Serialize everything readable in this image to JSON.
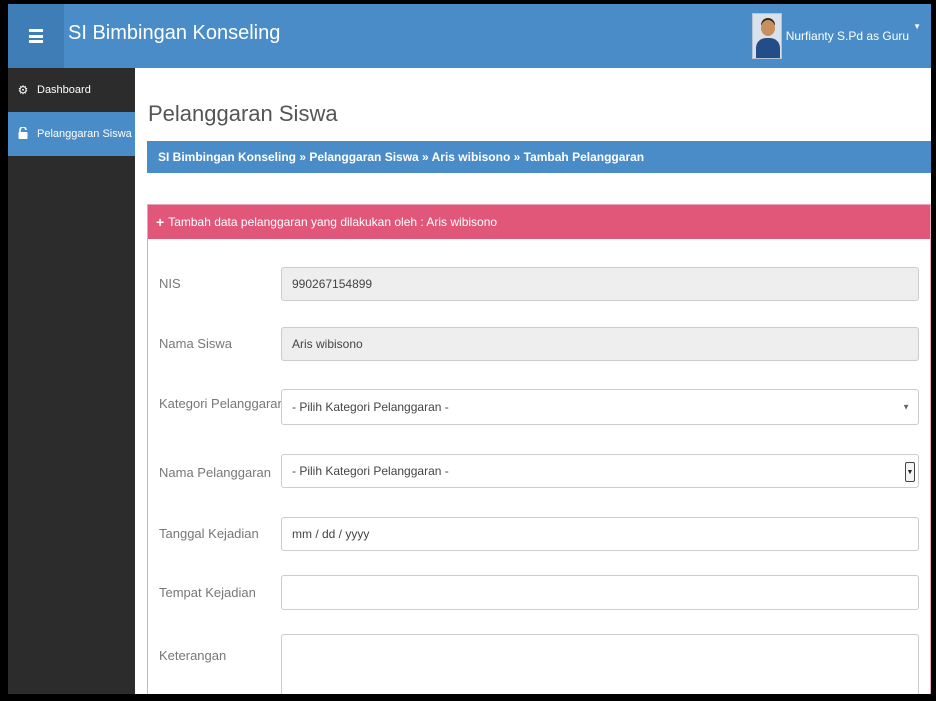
{
  "app": {
    "title": "SI Bimbingan Konseling"
  },
  "user": {
    "name": "Nurfianty S.Pd as Guru"
  },
  "sidebar": {
    "items": [
      {
        "label": "Dashboard",
        "icon": "dashboard-icon"
      },
      {
        "label": "Pelanggaran Siswa",
        "icon": "unlock-icon"
      }
    ]
  },
  "page": {
    "title": "Pelanggaran Siswa",
    "breadcrumb": "SI Bimbingan Konseling » Pelanggaran Siswa » Aris wibisono » Tambah Pelanggaran"
  },
  "panel": {
    "heading": "Tambah data pelanggaran yang dilakukan oleh : Aris wibisono"
  },
  "form": {
    "nis": {
      "label": "NIS",
      "value": "990267154899"
    },
    "nama_siswa": {
      "label": "Nama Siswa",
      "value": "Aris wibisono"
    },
    "kategori": {
      "label": "Kategori Pelanggaran",
      "value": "- Pilih Kategori Pelanggaran -"
    },
    "nama_pelanggaran": {
      "label": "Nama Pelanggaran",
      "value": "- Pilih Kategori Pelanggaran -"
    },
    "tanggal": {
      "label": "Tanggal Kejadian",
      "value": "mm / dd / yyyy"
    },
    "tempat": {
      "label": "Tempat Kejadian",
      "value": ""
    },
    "keterangan": {
      "label": "Keterangan",
      "value": ""
    }
  },
  "colors": {
    "primary": "#4a8cc7",
    "panel_heading": "#e0577a",
    "sidebar": "#2c2c2c"
  }
}
